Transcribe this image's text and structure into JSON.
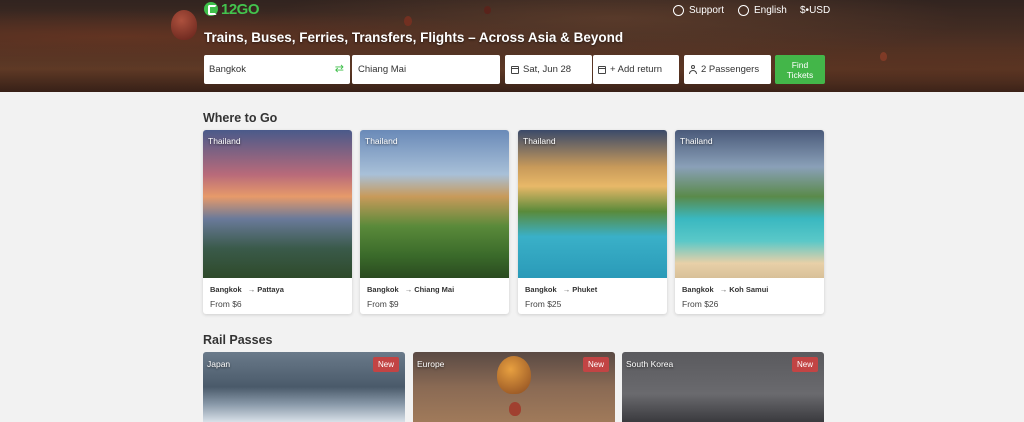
{
  "header": {
    "logo_text": "12GO",
    "nav": {
      "support": "Support",
      "language": "English",
      "currency": "$•USD"
    },
    "headline": "Trains, Buses, Ferries, Transfers, Flights – Across Asia & Beyond"
  },
  "search": {
    "from": "Bangkok",
    "to": "Chiang Mai",
    "date": "Sat, Jun 28",
    "return": "+ Add return",
    "passengers": "2 Passengers",
    "find_label": "Find Tickets"
  },
  "where_to_go": {
    "title": "Where to Go",
    "cards": [
      {
        "country": "Thailand",
        "from_city": "Bangkok",
        "to_city": "Pattaya",
        "price": "From $6"
      },
      {
        "country": "Thailand",
        "from_city": "Bangkok",
        "to_city": "Chiang Mai",
        "price": "From $9"
      },
      {
        "country": "Thailand",
        "from_city": "Bangkok",
        "to_city": "Phuket",
        "price": "From $25"
      },
      {
        "country": "Thailand",
        "from_city": "Bangkok",
        "to_city": "Koh Samui",
        "price": "From $26"
      }
    ]
  },
  "rail_passes": {
    "title": "Rail Passes",
    "cards": [
      {
        "country": "Japan",
        "badge": "New"
      },
      {
        "country": "Europe",
        "badge": "New"
      },
      {
        "country": "South Korea",
        "badge": "New"
      }
    ]
  },
  "colors": {
    "brand_green": "#43b649",
    "badge_red": "#c24444"
  }
}
